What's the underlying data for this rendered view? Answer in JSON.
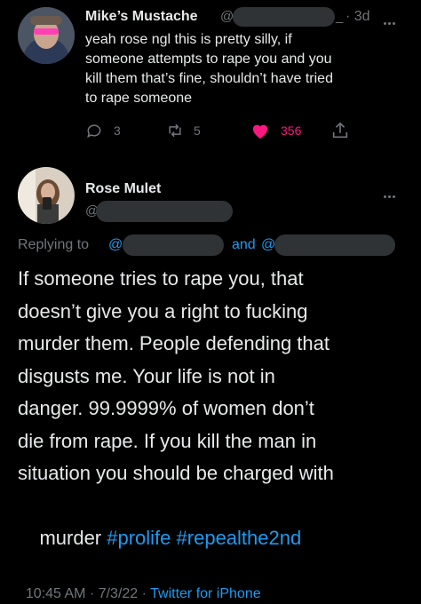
{
  "reply_tweet": {
    "author_name": "Mike’s Mustache",
    "handle_prefix": "@",
    "handle_suffix": "_",
    "time": "· 3d",
    "text_lines": [
      "yeah rose ngl this is pretty silly, if",
      "someone attempts to rape you and you",
      "kill them that’s fine, shouldn’t have tried",
      "to rape someone"
    ],
    "stats": {
      "replies": "3",
      "retweets": "5",
      "likes": "356"
    }
  },
  "main_tweet": {
    "author_name": "Rose Mulet",
    "handle_prefix": "@",
    "replying_to_label": "Replying to",
    "replying_at1": "@",
    "replying_and": "and",
    "replying_at2": "@",
    "text_lines": [
      "If someone tries to rape you, that",
      "doesn’t give you a right to fucking",
      "murder them. People defending that",
      "disgusts me. Your life is not in",
      "danger. 99.9999% of women don’t",
      "die from rape. If you kill the man in",
      "situation you should be charged with"
    ],
    "last_line_prefix": "murder ",
    "hashtag1": "#prolife",
    "hashtag2": "#repealthe2nd",
    "meta_time": "10:45 AM · 7/3/22 ·",
    "meta_source": "Twitter for iPhone"
  },
  "colors": {
    "accent": "#1d9bf0",
    "like": "#f91880",
    "muted": "#71767b"
  }
}
